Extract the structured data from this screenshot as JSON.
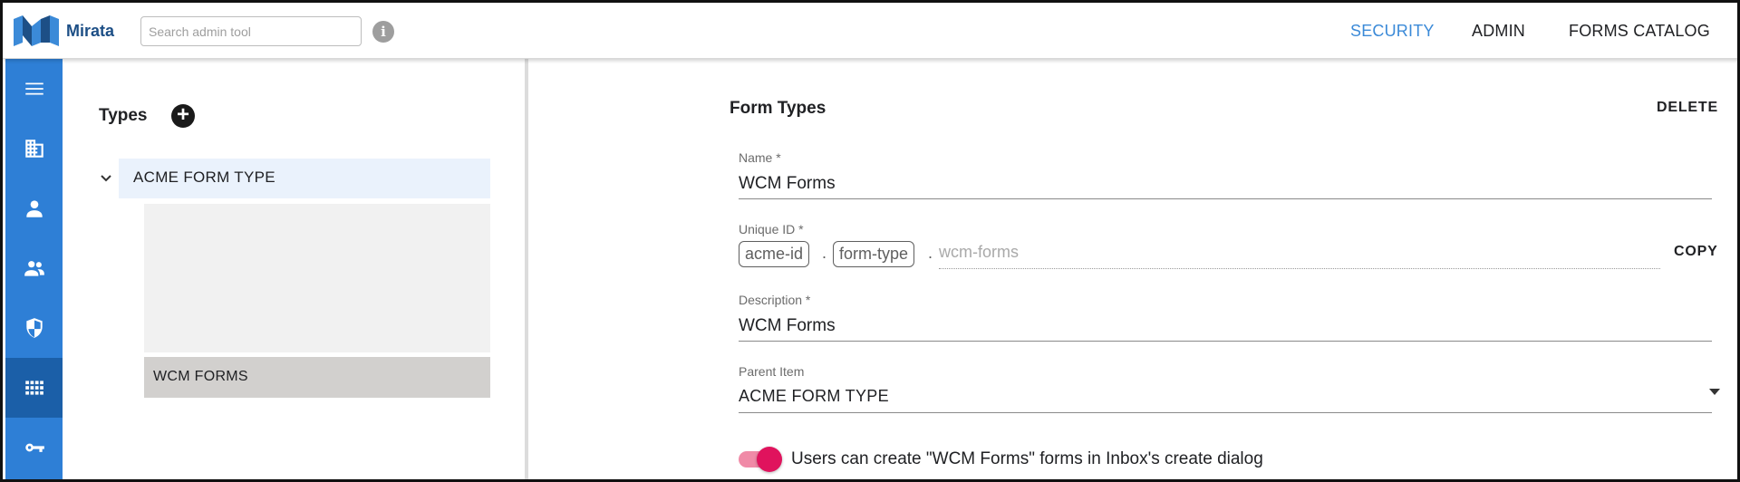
{
  "header": {
    "logo_text": "Mirata",
    "search_placeholder": "Search admin tool",
    "info_icon_glyph": "i",
    "nav": [
      "SECURITY",
      "ADMIN",
      "FORMS CATALOG"
    ],
    "active_nav": "SECURITY",
    "accent_color": "#3b8ad8"
  },
  "rail": {
    "color": "#2e7fd6",
    "active_color": "#1b5fa8",
    "items": [
      {
        "icon": "menu-icon"
      },
      {
        "icon": "building-icon"
      },
      {
        "icon": "person-icon"
      },
      {
        "icon": "people-icon"
      },
      {
        "icon": "shield-icon"
      },
      {
        "icon": "grid-icon",
        "active": true
      },
      {
        "icon": "key-icon"
      }
    ]
  },
  "types": {
    "title": "Types",
    "add_icon_glyph": "+",
    "parent": {
      "label": "ACME FORM TYPE",
      "expanded": true
    },
    "child": {
      "label": "WCM FORMS"
    }
  },
  "form": {
    "title": "Form Types",
    "delete_label": "DELETE",
    "name": {
      "label": "Name *",
      "value": "WCM Forms"
    },
    "unique_id": {
      "label": "Unique ID *",
      "chips": [
        "acme-id",
        "form-type"
      ],
      "separator": ".",
      "placeholder": "wcm-forms",
      "copy_label": "COPY"
    },
    "description": {
      "label": "Description *",
      "value": "WCM Forms"
    },
    "parent_item": {
      "label": "Parent Item",
      "value": "ACME FORM TYPE"
    },
    "toggle": {
      "on": true,
      "label": "Users can create \"WCM Forms\" forms in Inbox's create dialog",
      "color": "#e0135d"
    }
  }
}
